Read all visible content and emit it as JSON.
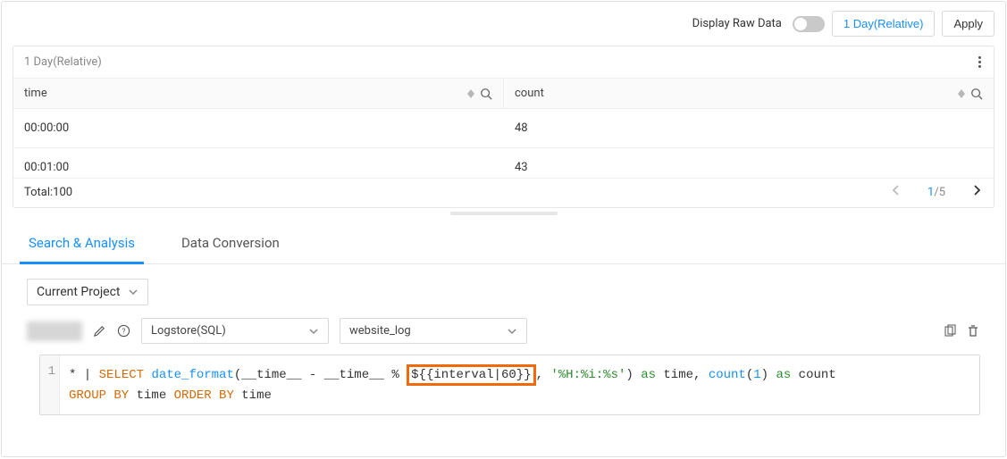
{
  "topbar": {
    "display_raw_label": "Display Raw Data",
    "range_button": "1 Day(Relative)",
    "apply_button": "Apply"
  },
  "panel": {
    "title": "1 Day(Relative)",
    "columns": {
      "time": "time",
      "count": "count"
    },
    "rows": [
      {
        "time": "00:00:00",
        "count": "48"
      },
      {
        "time": "00:01:00",
        "count": "43"
      }
    ],
    "total_label": "Total:100",
    "pager": {
      "current": "1",
      "sep": "/",
      "total": "5"
    }
  },
  "tabs": {
    "search": "Search & Analysis",
    "convert": "Data Conversion"
  },
  "selectors": {
    "project": "Current Project",
    "logstore": "Logstore(SQL)",
    "dataset": "website_log"
  },
  "editor": {
    "line_no": "1",
    "t_star_pipe": "* | ",
    "t_select": "SELECT",
    "t_date_format": "date_format",
    "t_open": "(",
    "t_time1": "__time__",
    "t_minus": " - ",
    "t_time2": "__time__",
    "t_mod": " % ",
    "t_interval": "${{interval|60}}",
    "t_comma1": ", ",
    "t_fmt": "'%H:%i:%s'",
    "t_close": ")",
    "t_as1": " as ",
    "t_alias_time": "time",
    "t_comma2": ", ",
    "t_count": "count",
    "t_open2": "(",
    "t_one": "1",
    "t_close2": ")",
    "t_as2": " as ",
    "t_alias_count": "count",
    "t_group": "GROUP BY",
    "t_time3": " time ",
    "t_order": "ORDER BY",
    "t_time4": " time"
  }
}
